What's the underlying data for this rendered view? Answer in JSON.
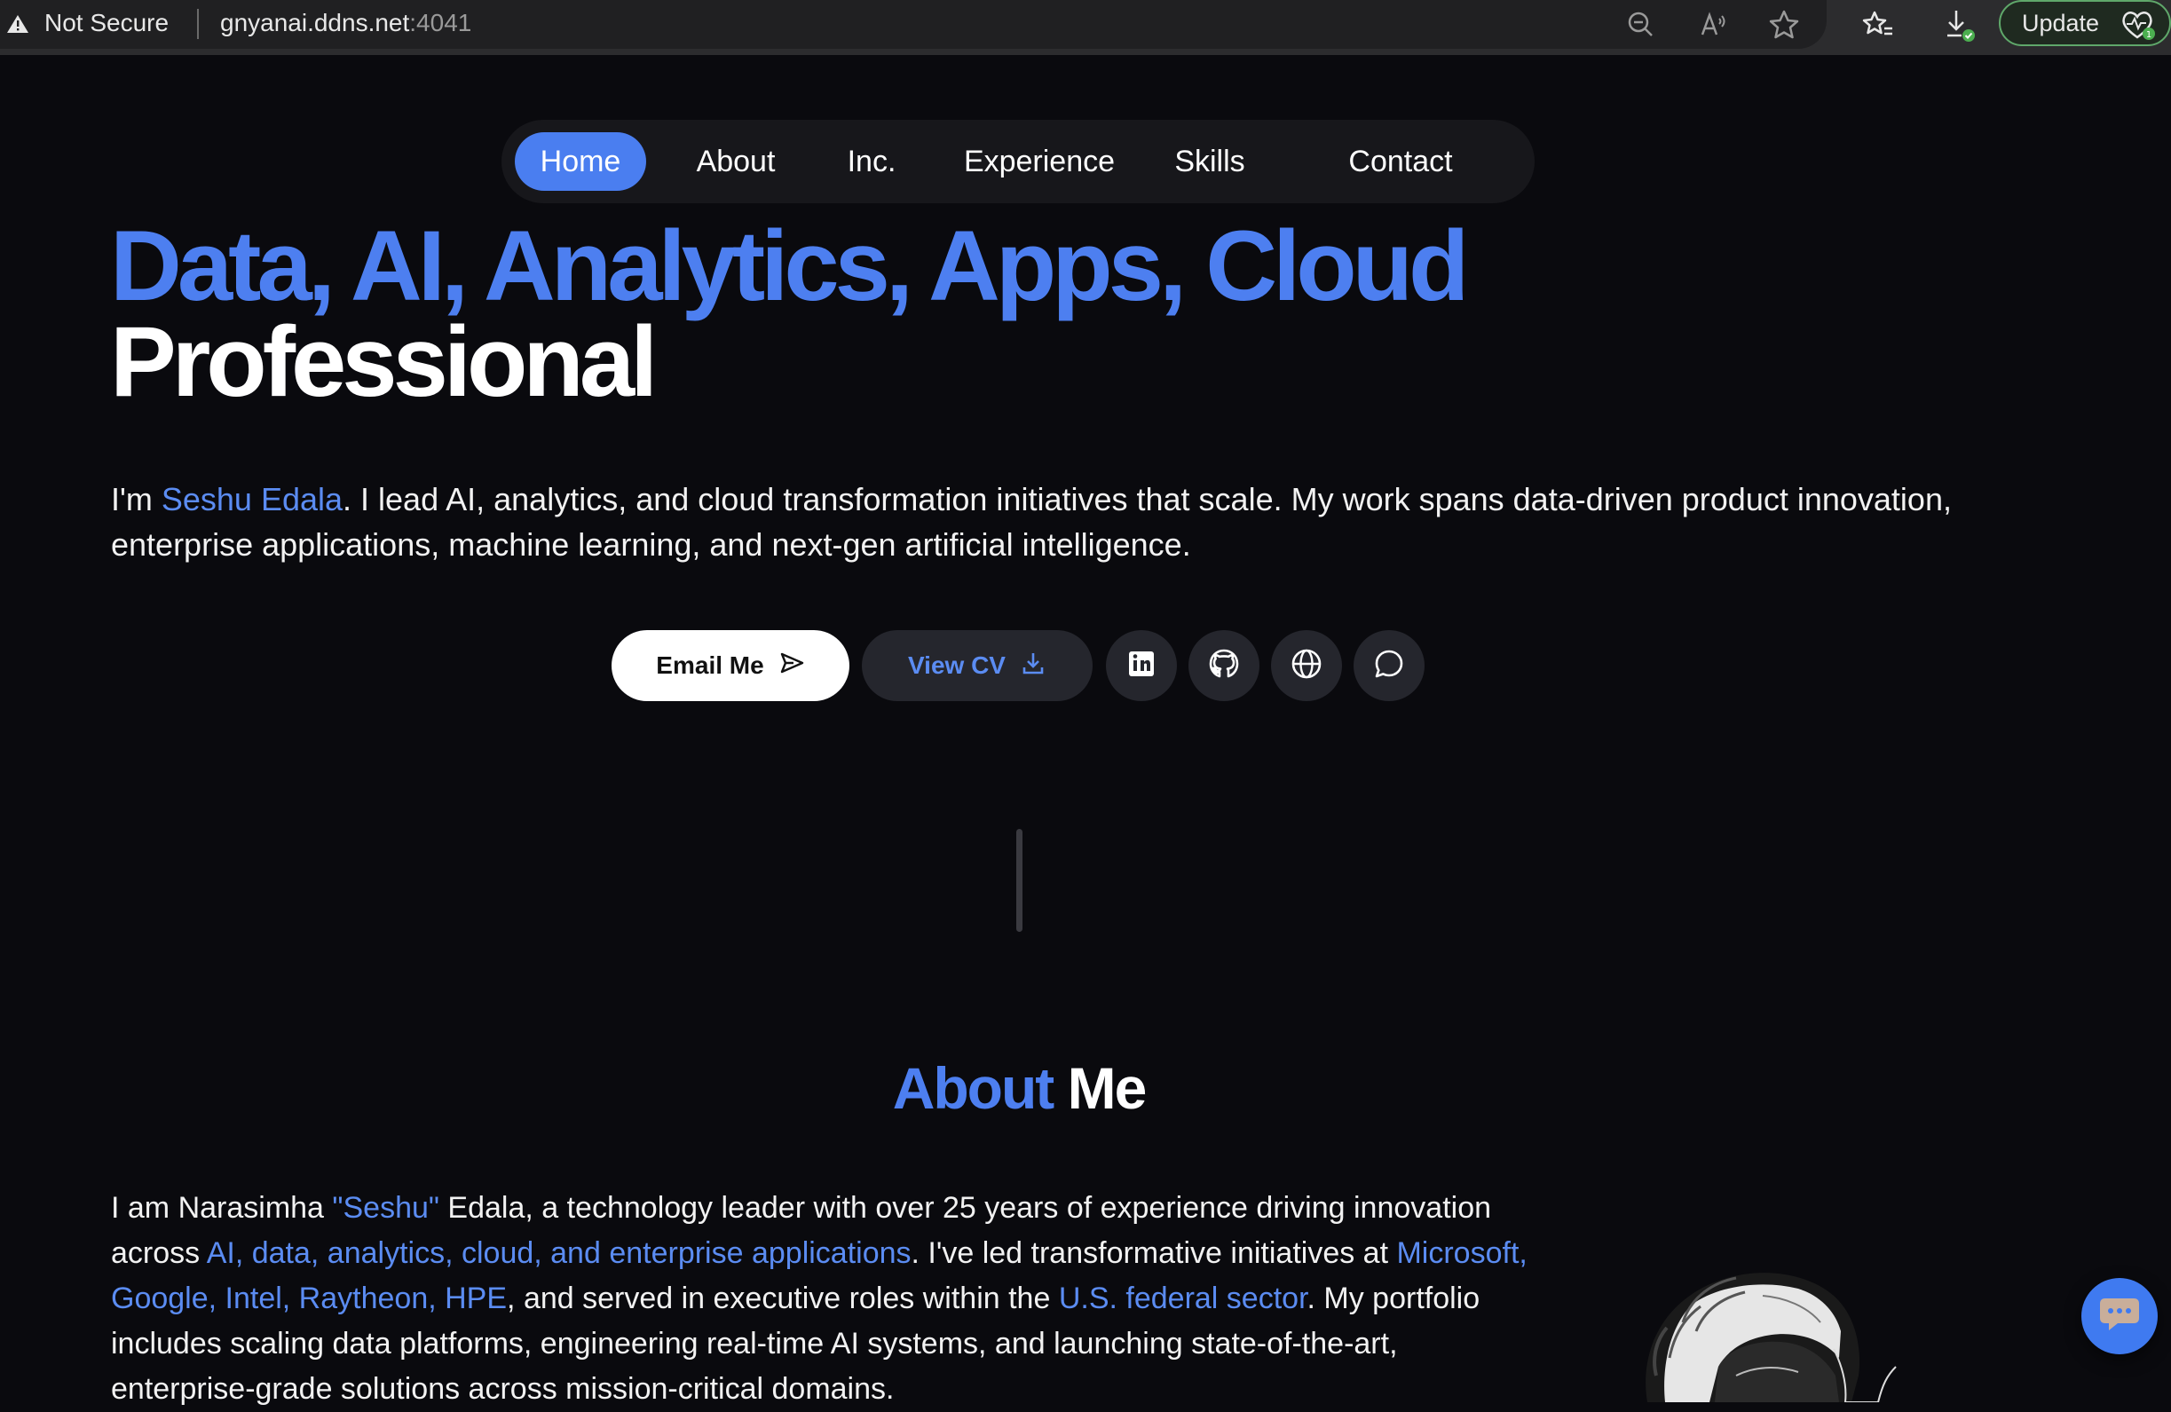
{
  "browser": {
    "security_label": "Not Secure",
    "url_host": "gnyanai.ddns.net",
    "url_port": ":4041",
    "update_label": "Update"
  },
  "nav": {
    "items": [
      {
        "label": "Home",
        "active": true
      },
      {
        "label": "About"
      },
      {
        "label": "Inc."
      },
      {
        "label": "Experience"
      },
      {
        "label": "Skills"
      },
      {
        "label": "Contact"
      }
    ]
  },
  "hero": {
    "title_blue": "Data, AI, Analytics, Apps, Cloud",
    "title_white": "Professional",
    "intro_prefix": "I'm ",
    "intro_name": "Seshu Edala",
    "intro_rest": ". I lead AI, analytics, and cloud transformation initiatives that scale. My work spans data-driven product innovation, enterprise applications, machine learning, and next-gen artificial intelligence."
  },
  "actions": {
    "email_label": "Email Me",
    "cv_label": "View CV",
    "icons": [
      "linkedin-icon",
      "github-icon",
      "globe-icon",
      "chat-icon"
    ]
  },
  "about": {
    "title_blue": "About",
    "title_white": " Me",
    "p1": "I am Narasimha ",
    "p1_hl": "\"Seshu\"",
    "p2": " Edala, a technology leader with over 25 years of experience driving innovation across ",
    "p2_hl": "AI, data, analytics, cloud, and enterprise applications",
    "p3": ". I've led transformative initiatives at ",
    "p3_hl": "Microsoft, Google, Intel, Raytheon, HPE",
    "p4": ", and served in executive roles within the ",
    "p4_hl": "U.S. federal sector",
    "p5": ". My portfolio includes scaling data platforms, engineering real-time AI systems, and launching state-of-the-art, enterprise-grade solutions across mission-critical domains."
  },
  "colors": {
    "accent": "#4d7ff0",
    "background": "#0a0a0e",
    "update_border": "#5fa86a"
  }
}
